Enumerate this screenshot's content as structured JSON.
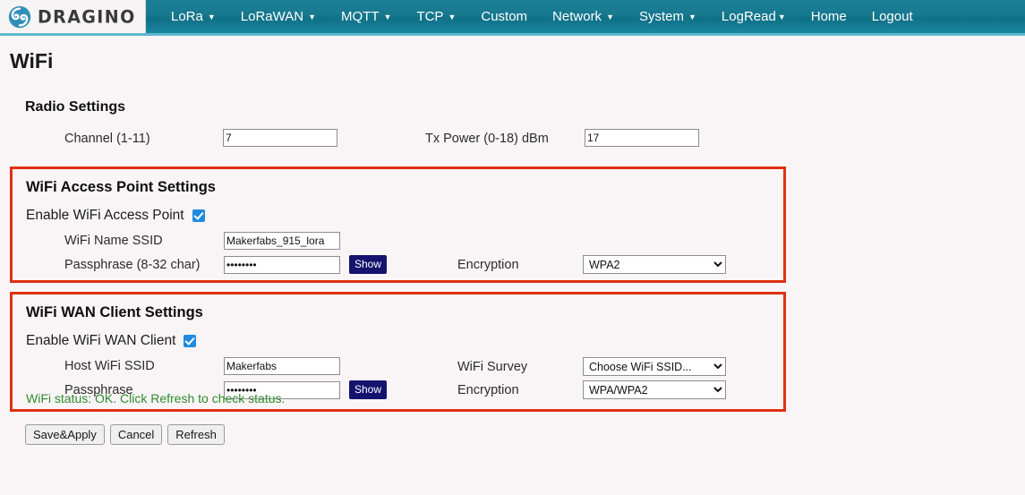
{
  "navbar": {
    "logo_text": "DRAGINO",
    "logo_icon": "dragino-swirl-icon",
    "items": [
      {
        "label": "LoRa",
        "has_caret": true
      },
      {
        "label": "LoRaWAN",
        "has_caret": true
      },
      {
        "label": "MQTT",
        "has_caret": true
      },
      {
        "label": "TCP",
        "has_caret": true
      },
      {
        "label": "Custom",
        "has_caret": false
      },
      {
        "label": "Network",
        "has_caret": true
      },
      {
        "label": "System",
        "has_caret": true
      },
      {
        "label": "LogRead",
        "has_caret": true
      },
      {
        "label": "Home",
        "has_caret": false
      },
      {
        "label": "Logout",
        "has_caret": false
      }
    ],
    "caret_glyph": "▼"
  },
  "page": {
    "title": "WiFi"
  },
  "radio_settings": {
    "heading": "Radio Settings",
    "channel_label": "Channel (1-11)",
    "channel_value": "7",
    "tx_power_label": "Tx Power (0-18) dBm",
    "tx_power_value": "17"
  },
  "access_point": {
    "heading": "WiFi Access Point Settings",
    "enable_label": "Enable WiFi Access Point",
    "enable_checked": true,
    "ssid_label": "WiFi Name SSID",
    "ssid_value": "Makerfabs_915_lora",
    "passphrase_label": "Passphrase (8-32 char)",
    "passphrase_value": "12345678",
    "show_button": "Show",
    "encryption_label": "Encryption",
    "encryption_value": "WPA2",
    "encryption_options": [
      "WPA2"
    ]
  },
  "wan_client": {
    "heading": "WiFi WAN Client Settings",
    "enable_label": "Enable WiFi WAN Client",
    "enable_checked": true,
    "ssid_label": "Host WiFi SSID",
    "ssid_value": "Makerfabs",
    "passphrase_label": "Passphrase",
    "passphrase_value": "12345678",
    "show_button": "Show",
    "survey_label": "WiFi Survey",
    "survey_value": "Choose WiFi SSID...",
    "survey_options": [
      "Choose WiFi SSID..."
    ],
    "encryption_label": "Encryption",
    "encryption_value": "WPA/WPA2",
    "encryption_options": [
      "WPA/WPA2"
    ],
    "status_text": "WiFi status: OK. Click Refresh to check status."
  },
  "actions": {
    "save": "Save&Apply",
    "cancel": "Cancel",
    "refresh": "Refresh"
  },
  "colors": {
    "nav_bg": "#17798f",
    "nav_border": "#5fb8cc",
    "page_bg": "#f9f5f6",
    "box_border": "#e03010",
    "checkbox": "#1f8ae0",
    "show_button": "#14146e",
    "status_green": "#2e8b2e"
  }
}
